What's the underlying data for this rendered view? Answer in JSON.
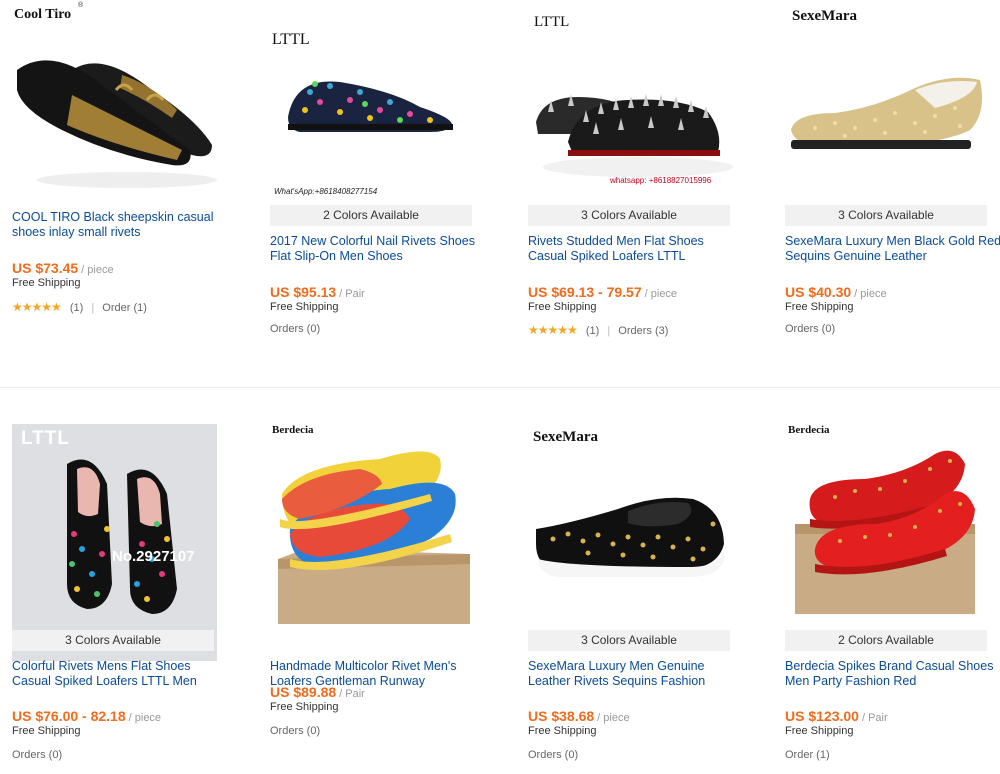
{
  "products": [
    {
      "brand": "Cool Tiro",
      "colors": "",
      "title": "COOL TIRO Black sheepskin casual shoes inlay small rivets",
      "price": "US $73.45",
      "unit": "/ piece",
      "shipping": "Free Shipping",
      "stars": "★★★★★",
      "reviews": "(1)",
      "orders": "Order (1)",
      "watermark": ""
    },
    {
      "brand": "LTTL",
      "colors": "2 Colors Available",
      "title": "2017 New Colorful Nail Rivets Shoes Flat Slip-On Men Shoes",
      "price": "US $95.13",
      "unit": "/ Pair",
      "shipping": "Free Shipping",
      "stars": "",
      "reviews": "",
      "orders": "Orders (0)",
      "watermark": "What'sApp:+8618408277154"
    },
    {
      "brand": "LTTL",
      "colors": "3 Colors Available",
      "title": "Rivets Studded Men Flat Shoes Casual Spiked Loafers LTTL",
      "price": "US $69.13 - 79.57",
      "unit": "/ piece",
      "shipping": "Free Shipping",
      "stars": "★★★★★",
      "reviews": "(1)",
      "orders": "Orders (3)",
      "watermark": "whatsapp: +8618827015996"
    },
    {
      "brand": "SexeMara",
      "colors": "3 Colors Available",
      "title": "SexeMara Luxury Men Black Gold Red Sequins Genuine Leather",
      "price": "US $40.30",
      "unit": "/ piece",
      "shipping": "Free Shipping",
      "stars": "",
      "reviews": "",
      "orders": "Orders (0)",
      "watermark": ""
    },
    {
      "brand": "LTTL",
      "colors": "3 Colors Available",
      "title": "Colorful Rivets Mens Flat Shoes Casual Spiked Loafers LTTL Men",
      "price": "US $76.00 - 82.18",
      "unit": "/ piece",
      "shipping": "Free Shipping",
      "stars": "",
      "reviews": "",
      "orders": "Orders (0)",
      "watermark": "No.2927107"
    },
    {
      "brand": "Berdecia",
      "colors": "",
      "title": "Handmade Multicolor Rivet Men's Loafers Gentleman Runway",
      "price": "US $89.88",
      "unit": "/ Pair",
      "shipping": "Free Shipping",
      "stars": "",
      "reviews": "",
      "orders": "Orders (0)",
      "watermark": ""
    },
    {
      "brand": "SexeMara",
      "colors": "3 Colors Available",
      "title": "SexeMara Luxury Men Genuine Leather Rivets Sequins Fashion",
      "price": "US $38.68",
      "unit": "/ piece",
      "shipping": "Free Shipping",
      "stars": "",
      "reviews": "",
      "orders": "Orders (0)",
      "watermark": ""
    },
    {
      "brand": "Berdecia",
      "colors": "2 Colors Available",
      "title": "Berdecia Spikes Brand Casual Shoes Men Party Fashion Red",
      "price": "US $123.00",
      "unit": "/ Pair",
      "shipping": "Free Shipping",
      "stars": "",
      "reviews": "",
      "orders": "Order (1)",
      "watermark": ""
    }
  ],
  "colors": {
    "price": "#f36b1c",
    "link": "#0a4b9e",
    "star": "#f5a623",
    "badge_bg": "#f1f1f1"
  }
}
